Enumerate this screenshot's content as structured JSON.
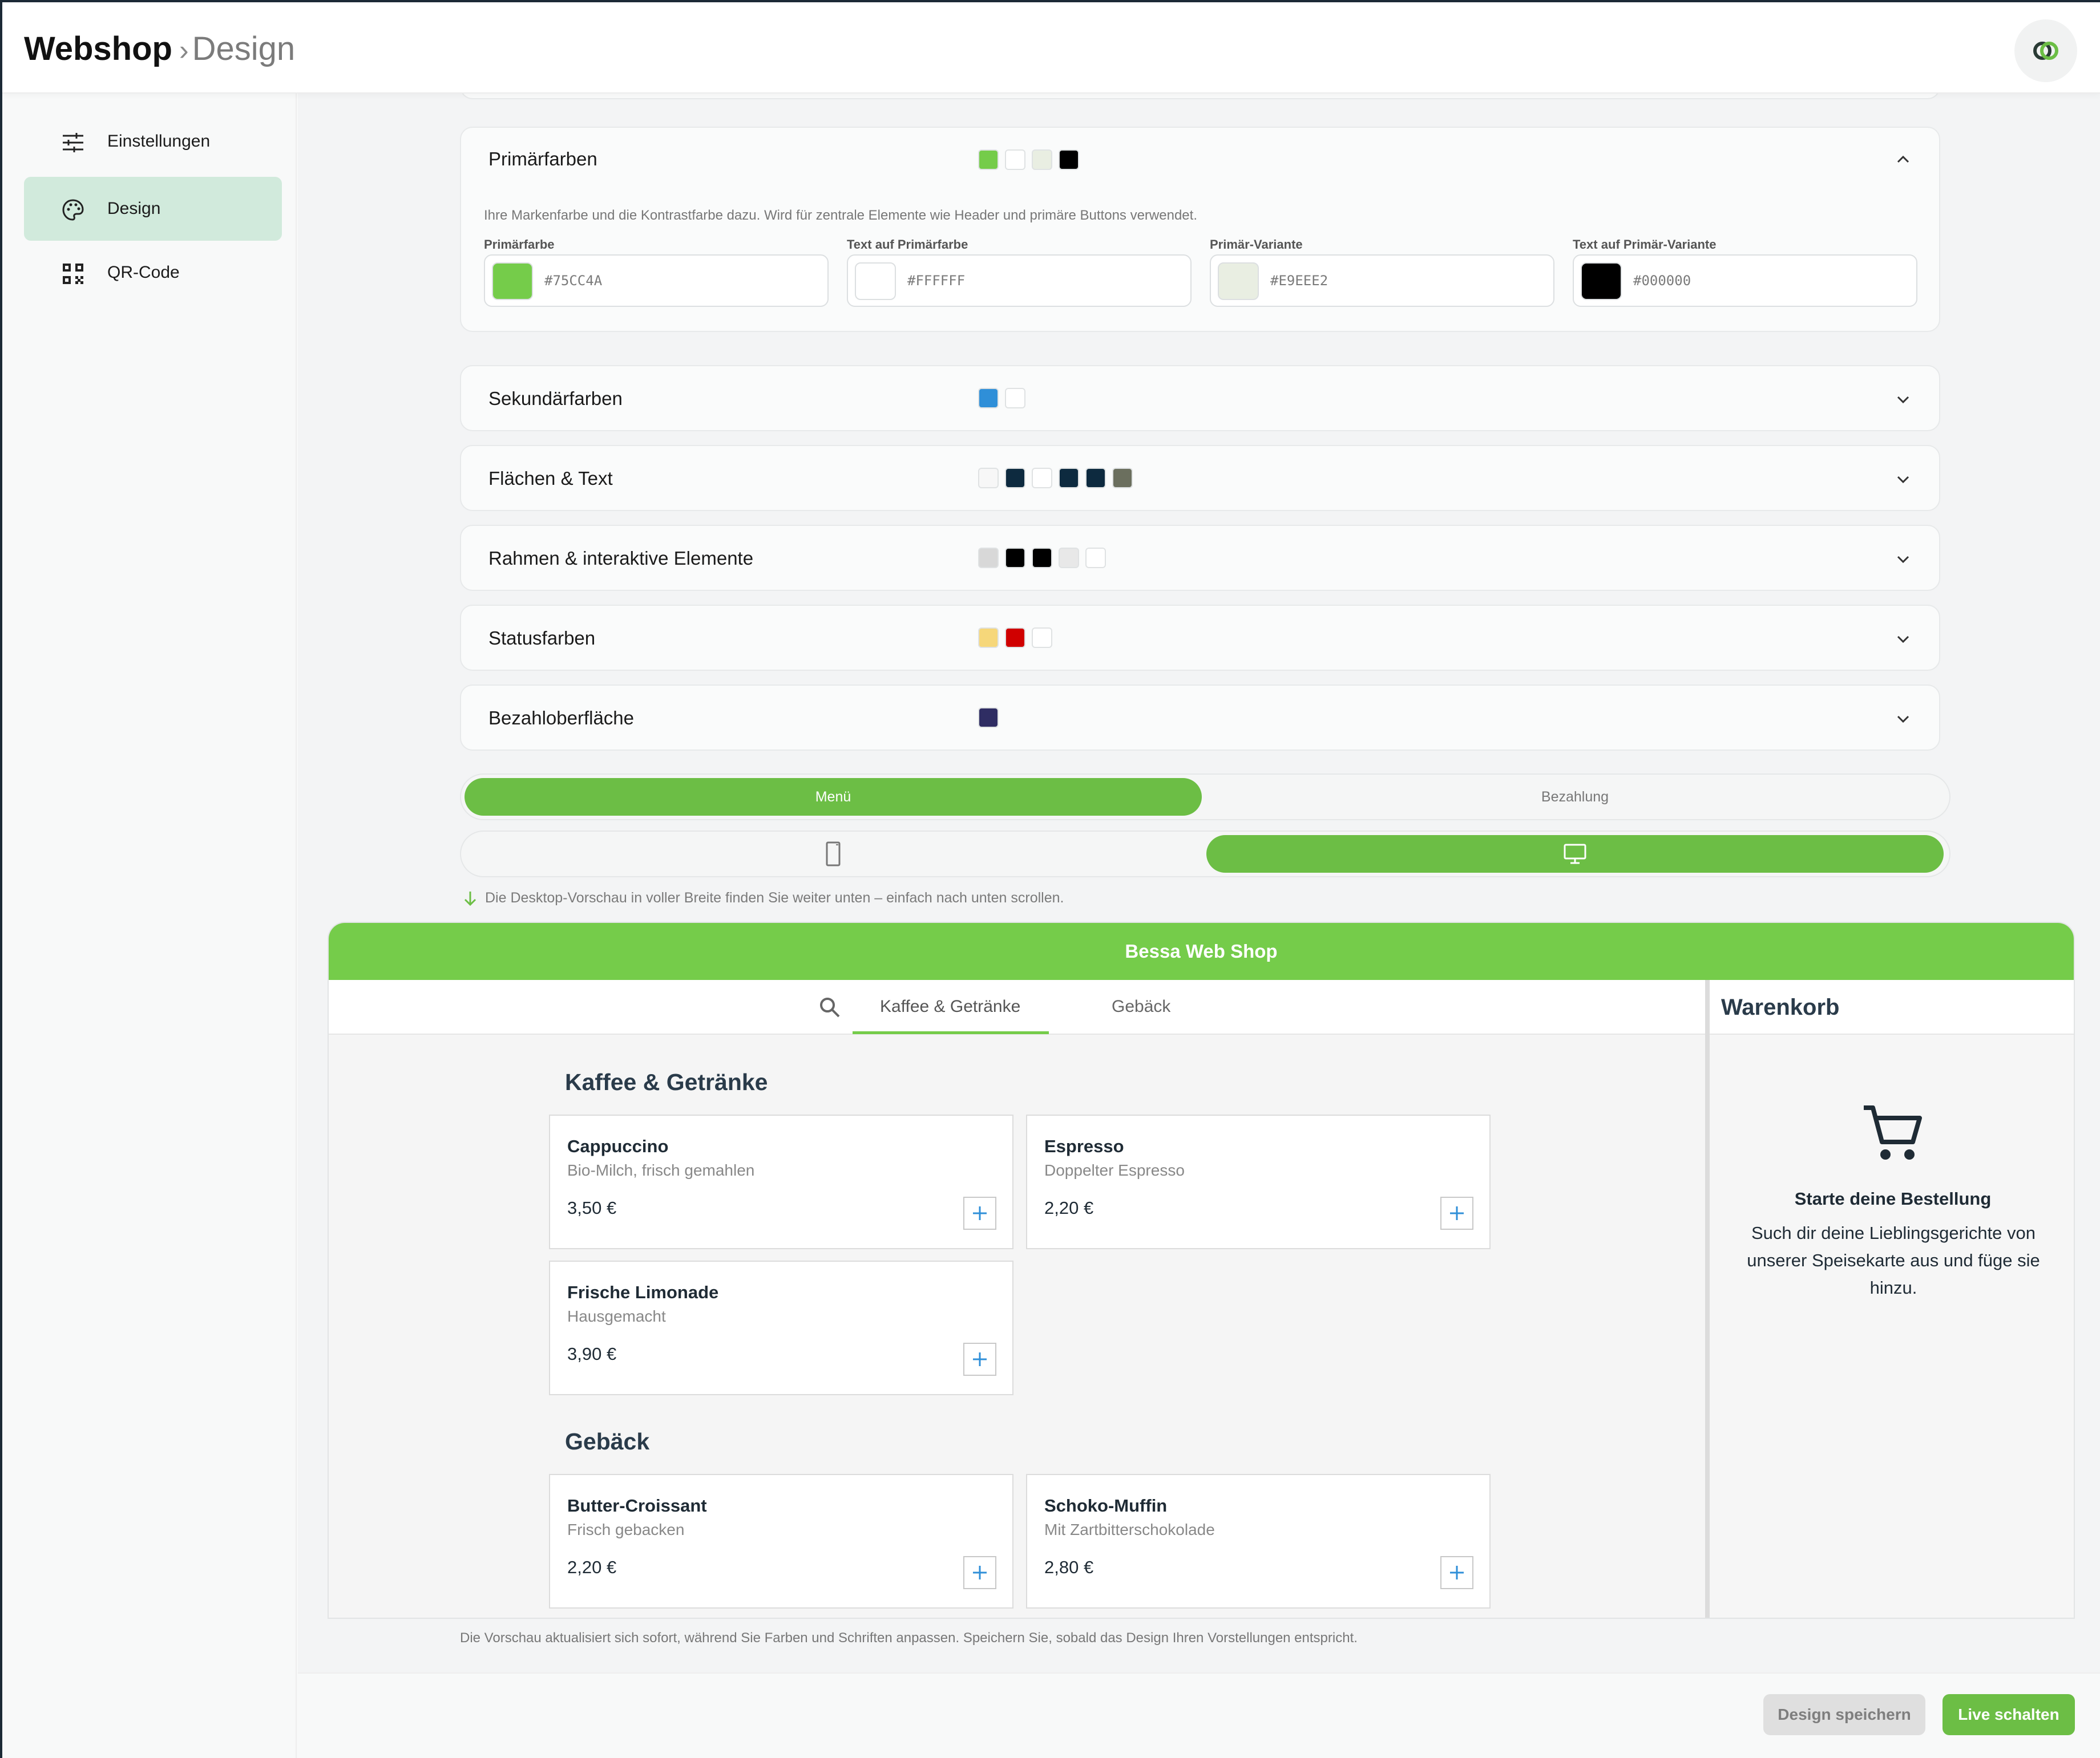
{
  "header": {
    "app": "Webshop",
    "separator": "›",
    "page": "Design"
  },
  "sidebar": {
    "items": [
      {
        "label": "Einstellungen",
        "icon": "sliders-icon",
        "active": false
      },
      {
        "label": "Design",
        "icon": "palette-icon",
        "active": true
      },
      {
        "label": "QR-Code",
        "icon": "qr-code-icon",
        "active": false
      }
    ]
  },
  "primary": {
    "title": "Primärfarben",
    "description": "Ihre Markenfarbe und die Kontrastfarbe dazu. Wird für zentrale Elemente wie Header und primäre Buttons verwendet.",
    "swatches": [
      "#75CC4A",
      "#FFFFFF",
      "#E9EEE2",
      "#000000"
    ],
    "fields": [
      {
        "label": "Primärfarbe",
        "value": "#75CC4A"
      },
      {
        "label": "Text auf Primärfarbe",
        "value": "#FFFFFF"
      },
      {
        "label": "Primär-Variante",
        "value": "#E9EEE2"
      },
      {
        "label": "Text auf Primär-Variante",
        "value": "#000000"
      }
    ]
  },
  "groups": [
    {
      "title": "Sekundärfarben",
      "swatches": [
        "#2f8fd8",
        "#ffffff"
      ]
    },
    {
      "title": "Flächen & Text",
      "swatches": [
        "#f7f7f7",
        "#0d2a3f",
        "#ffffff",
        "#0d2a3f",
        "#0d2a3f",
        "#6b6f5e"
      ]
    },
    {
      "title": "Rahmen & interaktive Elemente",
      "swatches": [
        "#d8d8d8",
        "#000000",
        "#000000",
        "#e8e8e8",
        "#ffffff"
      ]
    },
    {
      "title": "Statusfarben",
      "swatches": [
        "#f6d77a",
        "#d00000",
        "#ffffff"
      ]
    },
    {
      "title": "Bezahloberfläche",
      "swatches": [
        "#2f2d63"
      ]
    }
  ],
  "view_toggle": {
    "menu": "Menü",
    "payment": "Bezahlung"
  },
  "hint": "Die Desktop-Vorschau in voller Breite finden Sie weiter unten – einfach nach unten scrollen.",
  "preview": {
    "shop_name": "Bessa Web Shop",
    "tabs": [
      "Kaffee & Getränke",
      "Gebäck"
    ],
    "categories": [
      {
        "title": "Kaffee & Getränke",
        "products": [
          {
            "name": "Cappuccino",
            "desc": "Bio-Milch, frisch gemahlen",
            "price": "3,50 €"
          },
          {
            "name": "Espresso",
            "desc": "Doppelter Espresso",
            "price": "2,20 €"
          },
          {
            "name": "Frische Limonade",
            "desc": "Hausgemacht",
            "price": "3,90 €"
          }
        ]
      },
      {
        "title": "Gebäck",
        "products": [
          {
            "name": "Butter-Croissant",
            "desc": "Frisch gebacken",
            "price": "2,20 €"
          },
          {
            "name": "Schoko-Muffin",
            "desc": "Mit Zartbitterschokolade",
            "price": "2,80 €"
          }
        ]
      }
    ],
    "cart": {
      "title": "Warenkorb",
      "empty_title": "Starte deine Bestellung",
      "empty_text": "Such dir deine Lieblingsgerichte von unserer Speisekarte aus und füge sie hinzu."
    }
  },
  "footnote": "Die Vorschau aktualisiert sich sofort, während Sie Farben und Schriften anpassen. Speichern Sie, sobald das Design Ihren Vorstellungen entspricht.",
  "actions": {
    "save": "Design speichern",
    "live": "Live schalten"
  },
  "colors": {
    "accent": "#6cbe45",
    "brand": "#75CC4A",
    "active_nav": "#d1eadc",
    "text_dark": "#1f2b35",
    "add_icon": "#2f8fd8"
  }
}
